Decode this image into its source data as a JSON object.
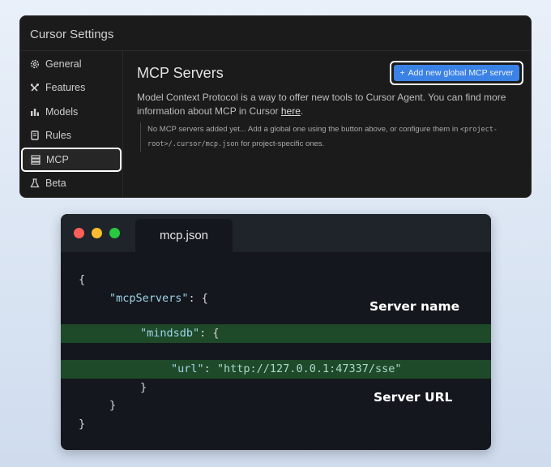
{
  "settings": {
    "title": "Cursor Settings",
    "sidebar": [
      {
        "label": "General",
        "icon": "gear-icon"
      },
      {
        "label": "Features",
        "icon": "tools-icon"
      },
      {
        "label": "Models",
        "icon": "bar-chart-icon"
      },
      {
        "label": "Rules",
        "icon": "document-icon"
      },
      {
        "label": "MCP",
        "icon": "server-icon",
        "active": true
      },
      {
        "label": "Beta",
        "icon": "flask-icon"
      }
    ],
    "heading": "MCP Servers",
    "add_button": "Add new global MCP server",
    "description": "Model Context Protocol is a way to offer new tools to Cursor Agent. You can find more information about MCP in Cursor",
    "description_link": "here",
    "note_text_1": "No MCP servers added yet... Add a global one using the button above, or configure them in",
    "note_code_1": "<project-root>/.cursor/mcp.json",
    "note_text_2": "for project-specific ones."
  },
  "editor": {
    "filename": "mcp.json",
    "lines": {
      "l1": "{",
      "l2_key": "\"mcpServers\"",
      "l2_rest": ": {",
      "l3_key": "\"mindsdb\"",
      "l3_rest": ": {",
      "l4_key": "\"url\"",
      "l4_sep": ": ",
      "l4_val": "\"http://127.0.0.1:47337/sse\"",
      "l5": "}",
      "l6": "}",
      "l7": "}"
    },
    "annotations": {
      "server_name": "Server name",
      "server_url": "Server URL"
    }
  },
  "colors": {
    "accent": "#3b82e6",
    "highlight": "#1e4a2a"
  }
}
